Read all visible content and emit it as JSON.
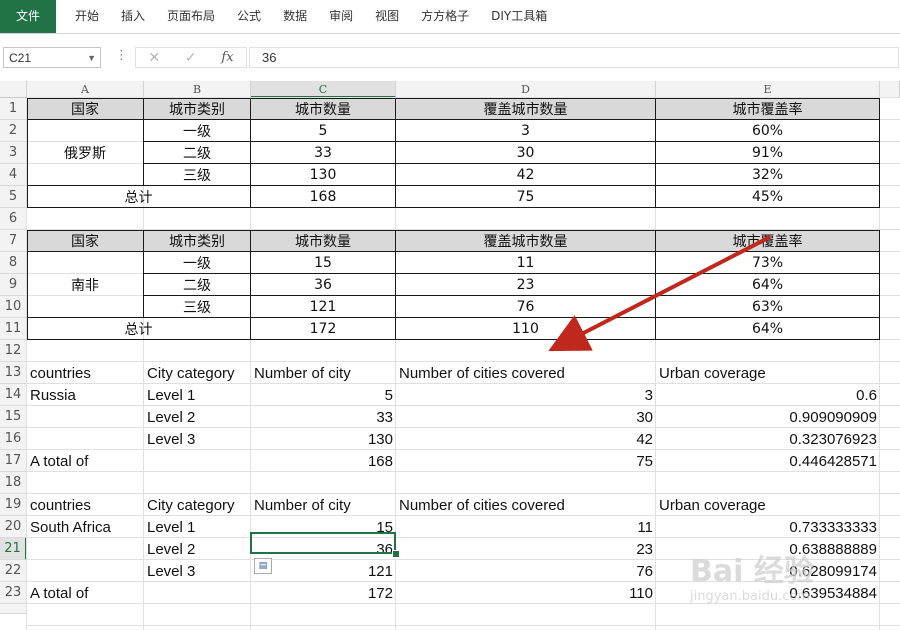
{
  "ribbon": {
    "tabs": [
      "文件",
      "开始",
      "插入",
      "页面布局",
      "公式",
      "数据",
      "审阅",
      "视图",
      "方方格子",
      "DIY工具箱"
    ]
  },
  "formula_bar": {
    "name_box": "C21",
    "value": "36"
  },
  "columns": [
    "A",
    "B",
    "C",
    "D",
    "E"
  ],
  "rows": [
    "1",
    "2",
    "3",
    "4",
    "5",
    "6",
    "7",
    "8",
    "9",
    "10",
    "11",
    "12",
    "13",
    "14",
    "15",
    "16",
    "17",
    "18",
    "19",
    "20",
    "21",
    "22",
    "23"
  ],
  "cn_table_russia": {
    "headers": [
      "国家",
      "城市类别",
      "城市数量",
      "覆盖城市数量",
      "城市覆盖率"
    ],
    "country": "俄罗斯",
    "rows": [
      [
        "一级",
        "5",
        "3",
        "60%"
      ],
      [
        "二级",
        "33",
        "30",
        "91%"
      ],
      [
        "三级",
        "130",
        "42",
        "32%"
      ]
    ],
    "total": [
      "总计",
      "168",
      "75",
      "45%"
    ]
  },
  "cn_table_sa": {
    "headers": [
      "国家",
      "城市类别",
      "城市数量",
      "覆盖城市数量",
      "城市覆盖率"
    ],
    "country": "南非",
    "rows": [
      [
        "一级",
        "15",
        "11",
        "73%"
      ],
      [
        "二级",
        "36",
        "23",
        "64%"
      ],
      [
        "三级",
        "121",
        "76",
        "63%"
      ]
    ],
    "total": [
      "总计",
      "172",
      "110",
      "64%"
    ]
  },
  "en_table_russia": {
    "headers": [
      "countries",
      "City category",
      "Number of city",
      "Number of cities covered",
      "Urban coverage"
    ],
    "country": "Russia",
    "rows": [
      [
        "Level 1",
        "5",
        "3",
        "0.6"
      ],
      [
        "Level 2",
        "33",
        "30",
        "0.909090909"
      ],
      [
        "Level 3",
        "130",
        "42",
        "0.323076923"
      ]
    ],
    "total": [
      "A total of",
      "168",
      "75",
      "0.446428571"
    ]
  },
  "en_table_sa": {
    "headers": [
      "countries",
      "City category",
      "Number of city",
      "Number of cities covered",
      "Urban coverage"
    ],
    "country": "South Africa",
    "rows": [
      [
        "Level 1",
        "15",
        "11",
        "0.733333333"
      ],
      [
        "Level 2",
        "36",
        "23",
        "0.638888889"
      ],
      [
        "Level 3",
        "121",
        "76",
        "0.628099174"
      ]
    ],
    "total": [
      "A total of",
      "172",
      "110",
      "0.639534884"
    ]
  },
  "annotation_arrow_color": "#c0281e",
  "accent_color": "#217346",
  "watermark": {
    "big": "Bai 经验",
    "small": "jingyan.baidu.com"
  }
}
